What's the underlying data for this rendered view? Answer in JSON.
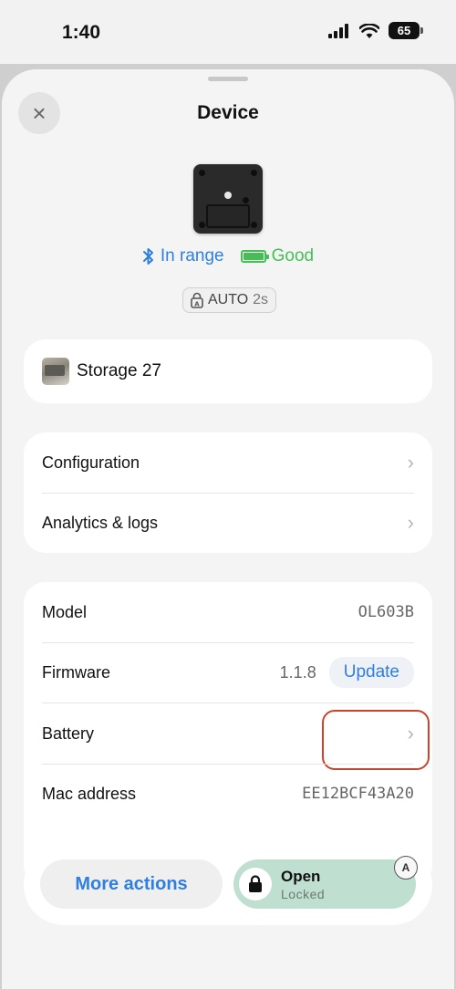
{
  "status_bar": {
    "time": "1:40",
    "battery_level": "65",
    "icons": [
      "signal-icon",
      "wifi-icon",
      "battery-icon"
    ]
  },
  "sheet": {
    "title": "Device",
    "close_icon": "×"
  },
  "device_status": {
    "range_label": "In range",
    "battery_label": "Good",
    "auto_label": "AUTO",
    "auto_interval": "2s"
  },
  "storage": {
    "name": "Storage 27"
  },
  "nav": {
    "items": [
      {
        "label": "Configuration",
        "chevron": "›"
      },
      {
        "label": "Analytics & logs",
        "chevron": "›"
      }
    ]
  },
  "info": {
    "model_label": "Model",
    "model_value": "OL603B",
    "firmware_label": "Firmware",
    "firmware_version": "1.1.8",
    "update_label": "Update",
    "battery_label": "Battery",
    "battery_chevron": "›",
    "mac_label": "Mac address",
    "mac_value": "EE12BCF43A20"
  },
  "actions": {
    "more_label": "More actions",
    "open_label": "Open",
    "open_status": "Locked",
    "auto_badge": "A"
  },
  "colors": {
    "accent_blue": "#2f7fe0",
    "good_green": "#45bf55",
    "open_green": "#bfe0d0",
    "highlight_red": "#c8452d"
  }
}
